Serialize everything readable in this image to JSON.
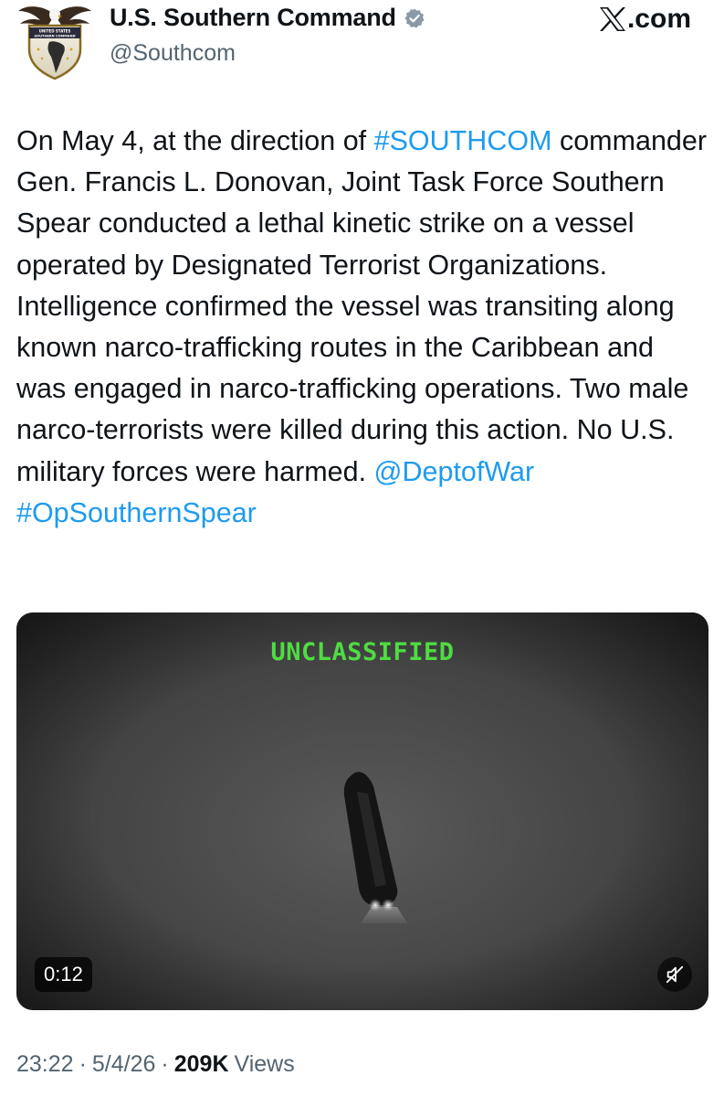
{
  "account": {
    "display_name": "U.S. Southern Command",
    "handle": "@Southcom",
    "verified": true,
    "verified_badge_color": "#8b98a5",
    "avatar_icon": "southcom-eagle-seal-icon",
    "avatar_seal_lines": [
      "UNITED STATES",
      "SOUTHERN COMMAND"
    ]
  },
  "source": {
    "logo_icon": "x-logo-icon",
    "label": ".com"
  },
  "tweet": {
    "segments": [
      {
        "text": "On May 4, at the direction of ",
        "type": "text"
      },
      {
        "text": "#SOUTHCOM",
        "type": "hashtag"
      },
      {
        "text": " commander Gen. Francis L. Donovan, Joint Task Force Southern Spear conducted a lethal kinetic strike on a vessel operated by Designated Terrorist Organizations. Intelligence confirmed the vessel was transiting along known narco-trafficking routes in the Caribbean and was engaged in narco-trafficking operations. Two male narco-terrorists were killed during this action. No U.S. military forces were harmed. ",
        "type": "text"
      },
      {
        "text": "@DeptofWar",
        "type": "mention"
      },
      {
        "text": " ",
        "type": "text"
      },
      {
        "text": "#OpSouthernSpear",
        "type": "hashtag"
      }
    ],
    "link_color": "#1d9bf0"
  },
  "media": {
    "type": "video",
    "overlay_text": "UNCLASSIFIED",
    "overlay_color": "#4fdc43",
    "duration": "0:12",
    "mute_icon": "speaker-muted-icon"
  },
  "meta": {
    "time": "23:22",
    "separator": "·",
    "date": "5/4/26",
    "views_count": "209K",
    "views_label": "Views"
  }
}
